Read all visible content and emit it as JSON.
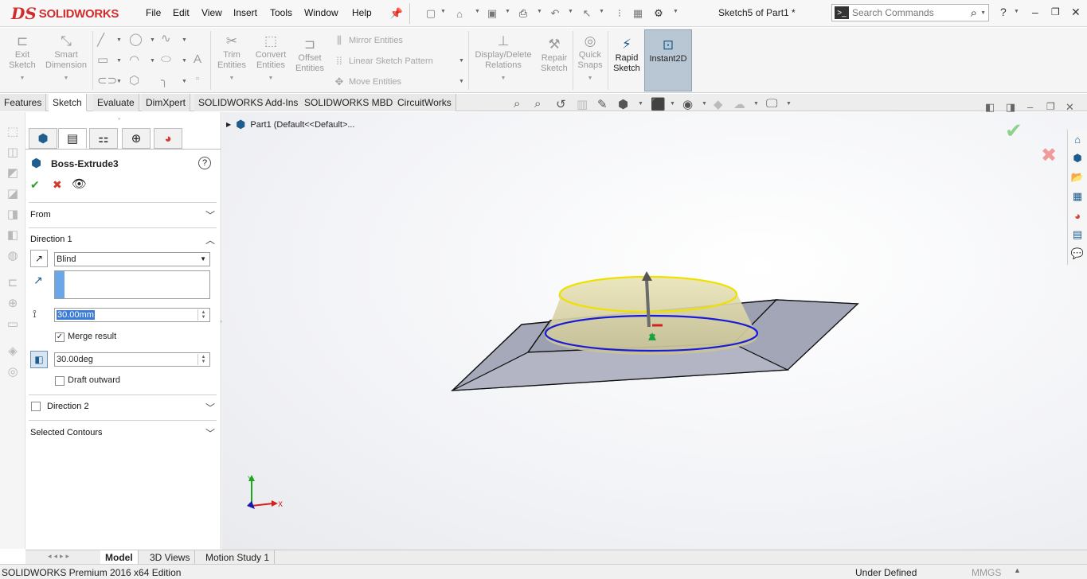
{
  "app": {
    "brand": "SOLIDWORKS",
    "doc_title": "Sketch5 of Part1 *"
  },
  "menu": [
    "File",
    "Edit",
    "View",
    "Insert",
    "Tools",
    "Window",
    "Help"
  ],
  "search": {
    "placeholder": "Search Commands"
  },
  "ribbon": {
    "exit_sketch": "Exit\nSketch",
    "smart_dimension": "Smart\nDimension",
    "trim_entities": "Trim\nEntities",
    "convert_entities": "Convert\nEntities",
    "offset_entities": "Offset\nEntities",
    "mirror_entities": "Mirror Entities",
    "linear_sketch_pattern": "Linear Sketch Pattern",
    "move_entities": "Move Entities",
    "display_delete_relations": "Display/Delete\nRelations",
    "repair_sketch": "Repair\nSketch",
    "quick_snaps": "Quick\nSnaps",
    "rapid_sketch": "Rapid\nSketch",
    "instant2d": "Instant2D"
  },
  "tabs": [
    "Features",
    "Sketch",
    "Evaluate",
    "DimXpert",
    "SOLIDWORKS Add-Ins",
    "SOLIDWORKS MBD",
    "CircuitWorks"
  ],
  "active_tab": "Sketch",
  "tree": {
    "root": "Part1  (Default<<Default>..."
  },
  "pm": {
    "title": "Boss-Extrude3",
    "from_label": "From",
    "direction1_label": "Direction 1",
    "end_condition": "Blind",
    "depth": "30.00mm",
    "merge_result": "Merge result",
    "draft_angle": "30.00deg",
    "draft_outward": "Draft outward",
    "direction2_label": "Direction 2",
    "selected_contours": "Selected Contours",
    "help": "?"
  },
  "triad": {
    "x": "X",
    "y": "Y"
  },
  "bottom_tabs": [
    "Model",
    "3D Views",
    "Motion Study 1"
  ],
  "status": {
    "edition": "SOLIDWORKS Premium 2016 x64 Edition",
    "state": "Under Defined",
    "units": "MMGS"
  },
  "colors": {
    "brand_red": "#d22b2b",
    "accept_green": "#2e9e2e",
    "cancel_red": "#d43a2b",
    "selection_blue": "#1a1ad9",
    "profile_yellow": "#f0e000",
    "face_gray": "#a6a9ba"
  }
}
